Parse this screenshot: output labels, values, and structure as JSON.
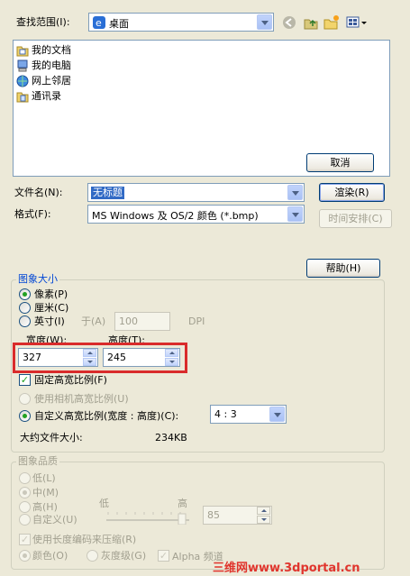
{
  "lookin": {
    "label": "查找范围(I):",
    "value": "桌面"
  },
  "toolbar": {
    "icons": [
      "back-icon",
      "up-folder-icon",
      "new-folder-icon",
      "view-menu-icon"
    ]
  },
  "files": {
    "items": [
      {
        "label": "我的文档",
        "icon": "folder-documents-icon"
      },
      {
        "label": "我的电脑",
        "icon": "computer-icon"
      },
      {
        "label": "网上邻居",
        "icon": "network-icon"
      },
      {
        "label": "通讯录",
        "icon": "addressbook-icon"
      }
    ]
  },
  "buttons": {
    "cancel": "取消",
    "save": "渲染(R)",
    "schedule": "时间安排(C)",
    "help": "帮助(H)"
  },
  "filename": {
    "label": "文件名(N):",
    "value": "无标题"
  },
  "format": {
    "label": "格式(F):",
    "value": "MS Windows 及 OS/2 颜色 (*.bmp)"
  },
  "imagesize": {
    "title": "图象大小",
    "unit_pixel": "像素(P)",
    "unit_cm": "厘米(C)",
    "unit_inch": "英寸(I)",
    "at_label": "于(A)",
    "dpi_value": "100",
    "dpi_label": "DPI",
    "width_label": "宽度(W):",
    "height_label": "高度(T):",
    "width_value": "327",
    "height_value": "245",
    "fixed_ratio": "固定高宽比例(F)",
    "camera_ratio": "使用相机高宽比例(U)",
    "custom_ratio": "自定义高宽比例(宽度 : 高度)(C):",
    "ratio_value": "4 : 3",
    "filesize_label": "大约文件大小:",
    "filesize_value": "234KB"
  },
  "quality": {
    "title": "图象品质",
    "low": "低(L)",
    "medium": "中(M)",
    "high": "高(H)",
    "custom": "自定义(U)",
    "slider_low": "低",
    "slider_high": "高",
    "slider_value": "85",
    "rle": "使用长度编码来压缩(R)",
    "color": "颜色(O)",
    "gray": "灰度级(G)",
    "alpha": "Alpha 频道"
  },
  "watermark": "三维网www.3dportal.cn",
  "colors": {
    "accent": "#0046d5",
    "highlight": "#d92b2b",
    "watermark": "#e0352d"
  }
}
